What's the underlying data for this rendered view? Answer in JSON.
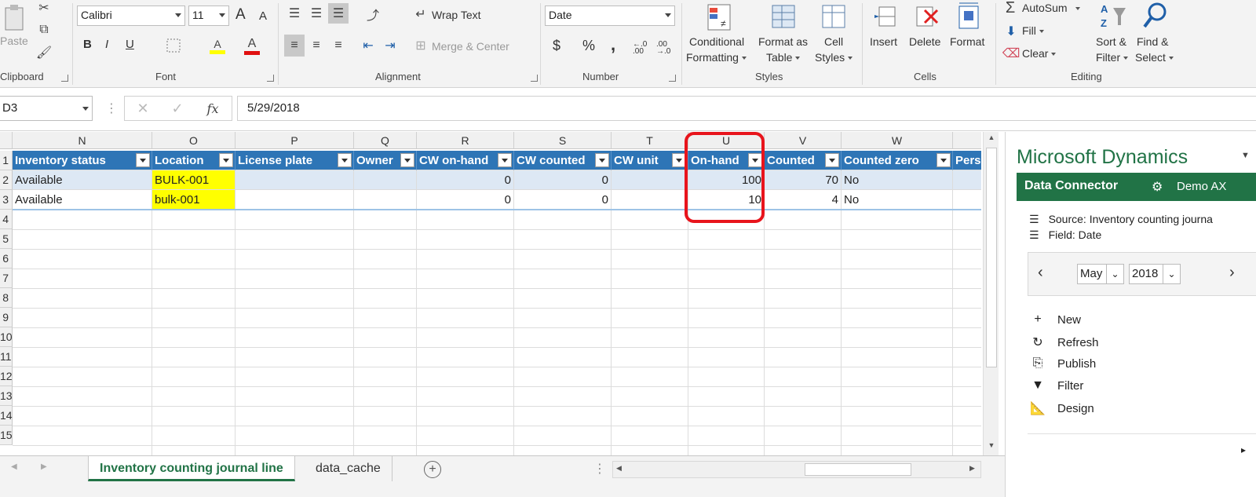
{
  "ribbon": {
    "clipboard": {
      "paste": "Paste",
      "label": "Clipboard"
    },
    "font": {
      "name": "Calibri",
      "size": "11",
      "grow": "A",
      "shrink": "A",
      "bold": "B",
      "italic": "I",
      "underline": "U",
      "fill_glyph": "A",
      "color_glyph": "A",
      "label": "Font"
    },
    "alignment": {
      "wrap": "Wrap Text",
      "merge": "Merge & Center",
      "label": "Alignment"
    },
    "number": {
      "format": "Date",
      "currency": "$",
      "percent": "%",
      "comma": ",",
      "inc_dec": "←.0 .00",
      "dec_dec": ".00 →.0",
      "label": "Number"
    },
    "styles": {
      "conditional1": "Conditional",
      "conditional2": "Formatting",
      "table1": "Format as",
      "table2": "Table",
      "cell1": "Cell",
      "cell2": "Styles",
      "label": "Styles"
    },
    "cells": {
      "insert": "Insert",
      "delete": "Delete",
      "format": "Format",
      "label": "Cells"
    },
    "editing": {
      "autosum": "AutoSum",
      "fill": "Fill",
      "clear": "Clear",
      "sort1": "Sort &",
      "sort2": "Filter",
      "find1": "Find &",
      "find2": "Select",
      "label": "Editing"
    }
  },
  "formula_bar": {
    "name_box": "D3",
    "fx": "fx",
    "value": "5/29/2018"
  },
  "grid": {
    "columns": [
      "N",
      "O",
      "P",
      "Q",
      "R",
      "S",
      "T",
      "U",
      "V",
      "W"
    ],
    "headers": [
      "Inventory status",
      "Location",
      "License plate",
      "Owner",
      "CW on-hand",
      "CW counted",
      "CW unit",
      "On-hand",
      "Counted",
      "Counted zero",
      "Pers"
    ],
    "rows": [
      [
        "Available",
        "BULK-001",
        "",
        "",
        "0",
        "0",
        "",
        "100",
        "70",
        "No"
      ],
      [
        "Available",
        "bulk-001",
        "",
        "",
        "0",
        "0",
        "",
        "10",
        "4",
        "No"
      ]
    ],
    "row_numbers": [
      "1",
      "2",
      "3",
      "4",
      "5",
      "6",
      "7",
      "8",
      "9",
      "10",
      "11",
      "12",
      "13",
      "14",
      "15"
    ]
  },
  "tabs": {
    "active": "Inventory counting journal line",
    "other": "data_cache"
  },
  "pane": {
    "brand": "Microsoft Dynamics",
    "title": "Data Connector",
    "env": "Demo AX",
    "source": "Source: Inventory counting journa",
    "field": "Field: Date",
    "month": "May",
    "year": "2018",
    "actions": [
      "New",
      "Refresh",
      "Publish",
      "Filter",
      "Design"
    ]
  },
  "colors": {
    "header_blue": "#2e75b6",
    "pane_green": "#217346",
    "highlight_red": "#e8141c",
    "yellow": "#ffff00"
  }
}
